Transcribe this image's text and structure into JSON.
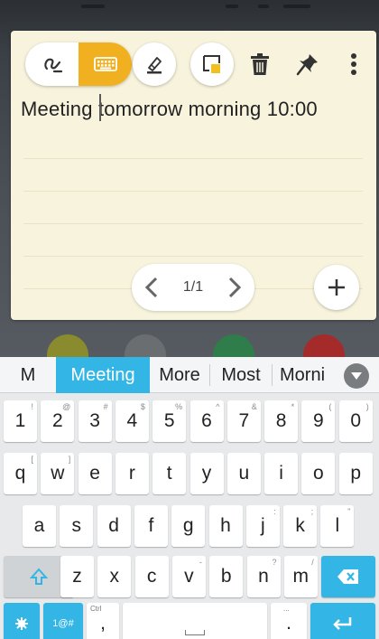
{
  "note": {
    "text": "Meeting tomorrow morning 10:00",
    "page_indicator": "1/1"
  },
  "toolbar": {
    "icons": [
      "handwriting-icon",
      "keyboard-icon",
      "highlighter-icon",
      "note-color-icon",
      "trash-icon",
      "pin-icon",
      "more-vert-icon"
    ]
  },
  "suggestions": {
    "items": [
      "M",
      "Meeting",
      "More",
      "Most",
      "Morni"
    ],
    "active": "Meeting"
  },
  "keyboard": {
    "row_numbers": [
      {
        "label": "1",
        "hint": "!"
      },
      {
        "label": "2",
        "hint": "@"
      },
      {
        "label": "3",
        "hint": "#"
      },
      {
        "label": "4",
        "hint": "$"
      },
      {
        "label": "5",
        "hint": "%"
      },
      {
        "label": "6",
        "hint": "^"
      },
      {
        "label": "7",
        "hint": "&"
      },
      {
        "label": "8",
        "hint": "*"
      },
      {
        "label": "9",
        "hint": "("
      },
      {
        "label": "0",
        "hint": ")"
      }
    ],
    "row_q": [
      {
        "label": "q",
        "hint": "["
      },
      {
        "label": "w",
        "hint": "]"
      },
      {
        "label": "e",
        "hint": ""
      },
      {
        "label": "r",
        "hint": ""
      },
      {
        "label": "t",
        "hint": ""
      },
      {
        "label": "y",
        "hint": ""
      },
      {
        "label": "u",
        "hint": ""
      },
      {
        "label": "i",
        "hint": ""
      },
      {
        "label": "o",
        "hint": ""
      },
      {
        "label": "p",
        "hint": ""
      }
    ],
    "row_a": [
      {
        "label": "a",
        "hint": ""
      },
      {
        "label": "s",
        "hint": ""
      },
      {
        "label": "d",
        "hint": ""
      },
      {
        "label": "f",
        "hint": ""
      },
      {
        "label": "g",
        "hint": ""
      },
      {
        "label": "h",
        "hint": ""
      },
      {
        "label": "j",
        "hint": ":"
      },
      {
        "label": "k",
        "hint": ";"
      },
      {
        "label": "l",
        "hint": "\""
      }
    ],
    "row_z": [
      {
        "label": "z",
        "hint": ""
      },
      {
        "label": "x",
        "hint": ""
      },
      {
        "label": "c",
        "hint": ""
      },
      {
        "label": "v",
        "hint": "-"
      },
      {
        "label": "b",
        "hint": ""
      },
      {
        "label": "n",
        "hint": "?"
      },
      {
        "label": "m",
        "hint": "/"
      }
    ],
    "symbols_key": "1@#",
    "comma_key": ",",
    "comma_hint": "Ctrl",
    "period_key": ".",
    "period_hint": "..."
  },
  "colors": {
    "accent_orange": "#f0b020",
    "accent_blue": "#33b6e5",
    "note_background": "#f7f3dc"
  }
}
